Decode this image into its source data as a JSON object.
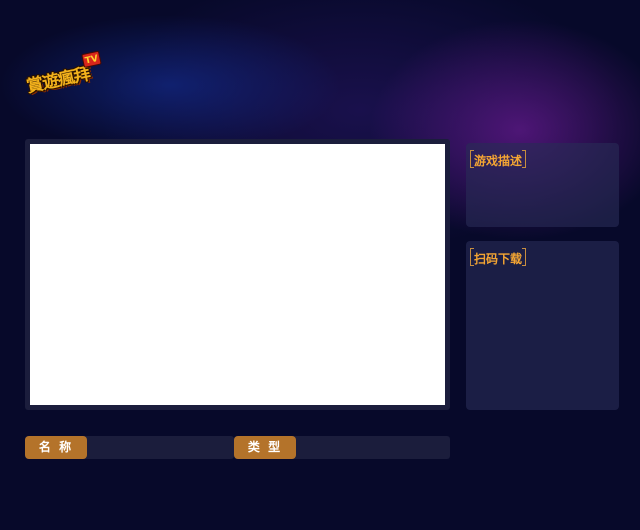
{
  "logo": {
    "text": "賞遊瘋拜",
    "badge": "TV"
  },
  "panels": {
    "description": {
      "title": "游戏描述",
      "body": ""
    },
    "download": {
      "title": "扫码下载"
    }
  },
  "info": {
    "name_label": "名  称",
    "name_value": "",
    "type_label": "类  型",
    "type_value": ""
  },
  "colors": {
    "background": "#07092a",
    "panel": "#282c56",
    "accent_orange": "#b4732a",
    "title_orange": "#f4a533"
  }
}
